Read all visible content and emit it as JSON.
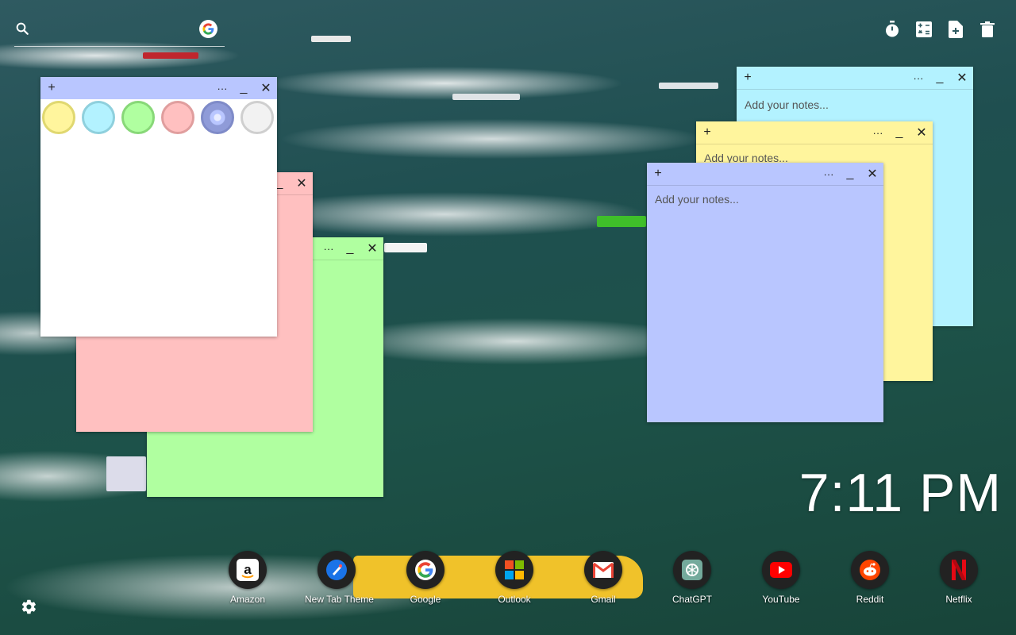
{
  "colors": {
    "yellow": "#fff59d",
    "cyan": "#b3f2ff",
    "green": "#b0ffa0",
    "pink": "#ffc0c0",
    "periwinkle": "#b9c6ff",
    "white": "#ffffff"
  },
  "icons": {
    "search": "search-icon",
    "google": "google-icon",
    "timer": "timer-icon",
    "calculator": "calculator-icon",
    "new_note": "new-note-icon",
    "trash": "trash-icon",
    "settings": "gear-icon"
  },
  "notes": {
    "placeholder": "Add your notes...",
    "plus": "+",
    "more": "···",
    "minimize": "_",
    "close": "✕"
  },
  "clock": {
    "time": "7:11 PM"
  },
  "dock": [
    {
      "label": "Amazon",
      "icon": "amazon-icon"
    },
    {
      "label": "New Tab Theme",
      "icon": "new-tab-theme-icon"
    },
    {
      "label": "Google",
      "icon": "google-icon"
    },
    {
      "label": "Outlook",
      "icon": "outlook-icon"
    },
    {
      "label": "Gmail",
      "icon": "gmail-icon"
    },
    {
      "label": "ChatGPT",
      "icon": "chatgpt-icon"
    },
    {
      "label": "YouTube",
      "icon": "youtube-icon"
    },
    {
      "label": "Reddit",
      "icon": "reddit-icon"
    },
    {
      "label": "Netflix",
      "icon": "netflix-icon"
    }
  ]
}
